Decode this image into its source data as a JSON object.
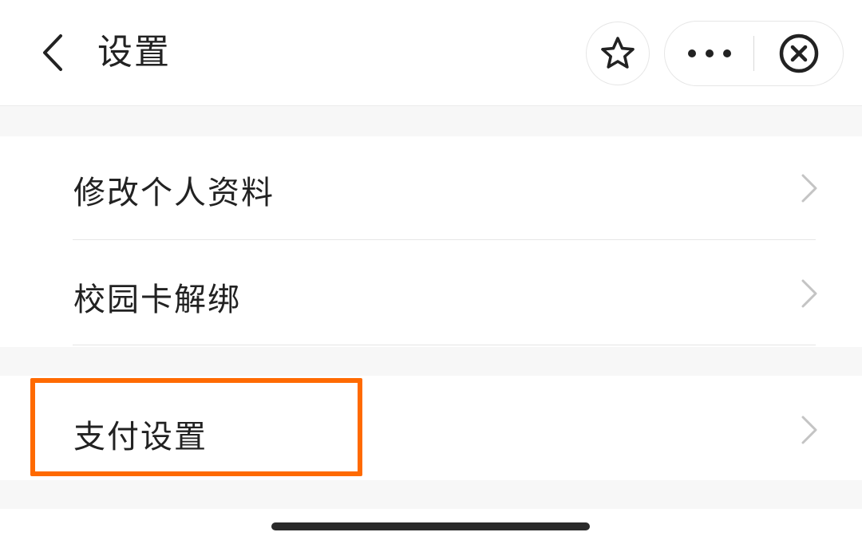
{
  "nav": {
    "title": "设置",
    "back_icon": "chevron-left-icon",
    "star_icon": "star-icon",
    "more_icon": "more-dots-icon",
    "close_icon": "close-circle-icon"
  },
  "settings": {
    "items": [
      {
        "label": "修改个人资料"
      },
      {
        "label": "校园卡解绑"
      },
      {
        "label": "支付设置"
      }
    ]
  },
  "colors": {
    "highlight": "#ff6a00",
    "background_gap": "#f7f7f7",
    "text": "#222222",
    "chevron": "#c4c4c4"
  }
}
